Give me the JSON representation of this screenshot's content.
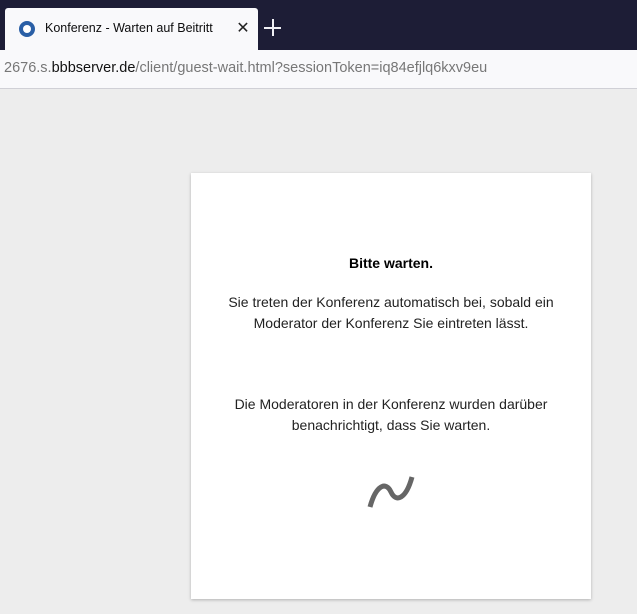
{
  "browser": {
    "tab": {
      "title": "Konferenz - Warten auf Beitritt",
      "close_symbol": "✕"
    },
    "url": {
      "prefix": "2676.s.",
      "host": "bbbserver.de",
      "path": "/client/guest-wait.html?sessionToken=iq84efjlq6kxv9eu"
    }
  },
  "wait_card": {
    "title": "Bitte warten.",
    "message_1": "Sie treten der Konferenz automatisch bei, sobald ein Moderator der Konferenz Sie eintreten lässt.",
    "message_2": "Die Moderatoren in der Konferenz wurden darüber benachrichtigt, dass Sie warten.",
    "spinner_icon": "loading-wave-icon"
  },
  "colors": {
    "tabstrip": "#1d1d36",
    "page_background": "#ededed",
    "favicon": "#2a5fa6",
    "spinner": "#666666"
  }
}
